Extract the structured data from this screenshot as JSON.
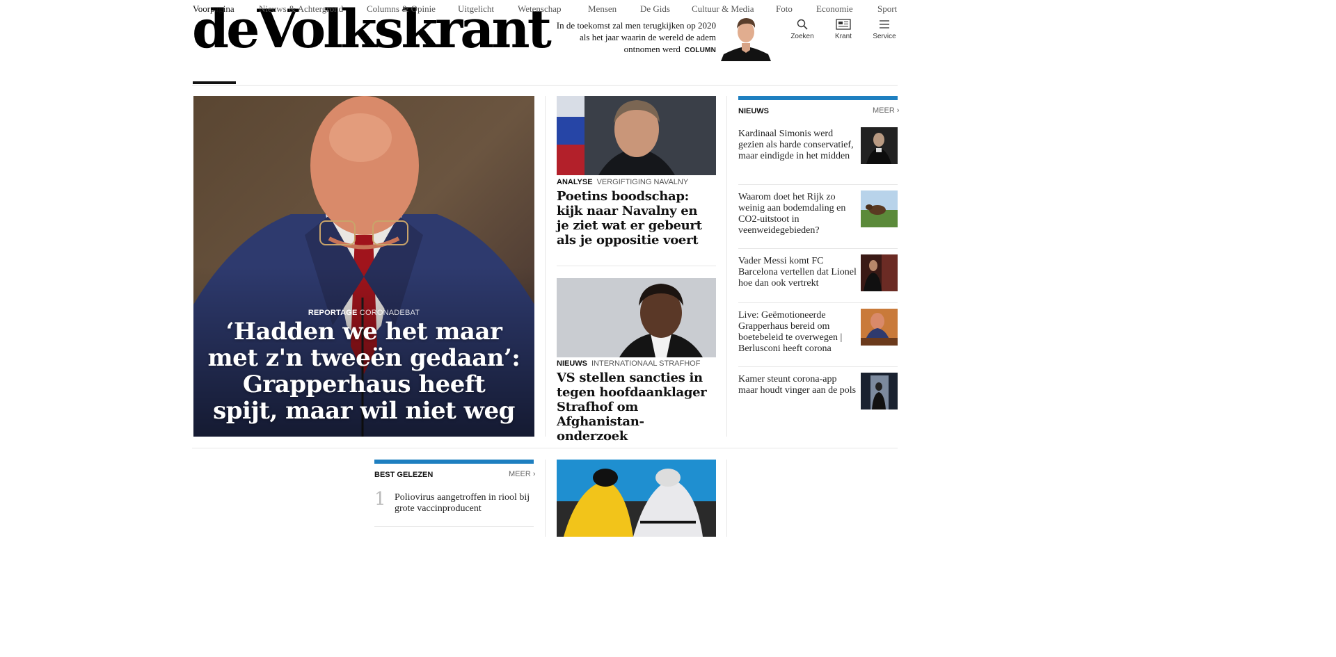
{
  "header": {
    "logo": "deVolkskrant",
    "promo": {
      "text": "In de toekomst zal men terugkijken op 2020 als het jaar waarin de wereld de adem ontnomen werd",
      "tag": "COLUMN"
    },
    "actions": [
      {
        "label": "Zoeken",
        "icon": "search-icon"
      },
      {
        "label": "Krant",
        "icon": "newspaper-icon"
      },
      {
        "label": "Service",
        "icon": "menu-icon"
      }
    ]
  },
  "nav": {
    "items": [
      "Voorpagina",
      "Nieuws & Achtergrond",
      "Columns & Opinie",
      "Uitgelicht",
      "Wetenschap",
      "Mensen",
      "De Gids",
      "Cultuur & Media",
      "Foto",
      "Economie",
      "Sport"
    ],
    "active": "Voorpagina"
  },
  "lead": {
    "label": "REPORTAGE",
    "sub": "CORONADEBAT",
    "title": "‘Hadden we het maar met z'n tweeën gedaan’: Grapperhaus heeft spijt, maar wil niet weg"
  },
  "mid": [
    {
      "label": "ANALYSE",
      "sub": "VERGIFTIGING NAVALNY",
      "title": "Poetins boodschap: kijk naar Navalny en je ziet wat er gebeurt als je oppositie voert"
    },
    {
      "label": "NIEUWS",
      "sub": "INTERNATIONAAL STRAFHOF",
      "title": "VS stellen sancties in tegen hoofdaanklager Strafhof om Afghanistan-onderzoek"
    }
  ],
  "news": {
    "heading": "NIEUWS",
    "more": "MEER",
    "items": [
      "Kardinaal Simonis werd gezien als harde conservatief, maar eindigde in het midden",
      "Waarom doet het Rijk zo weinig aan bodemdaling en CO2-uitstoot in veenweidegebieden?",
      "Vader Messi komt FC Barcelona vertellen dat Lionel hoe dan ook vertrekt",
      "Live: Geëmotioneerde Grapperhaus bereid om boetebeleid te overwegen | Berlusconi heeft corona",
      "Kamer steunt corona-app maar houdt vinger aan de pols"
    ]
  },
  "best": {
    "heading": "BEST GELEZEN",
    "more": "MEER",
    "items": [
      {
        "rank": "1",
        "text": "Poliovirus aangetroffen in riool bij grote vaccinproducent"
      }
    ]
  },
  "colors": {
    "accent": "#1e7fc0",
    "text": "#111111",
    "divider": "#e6e6e6"
  }
}
